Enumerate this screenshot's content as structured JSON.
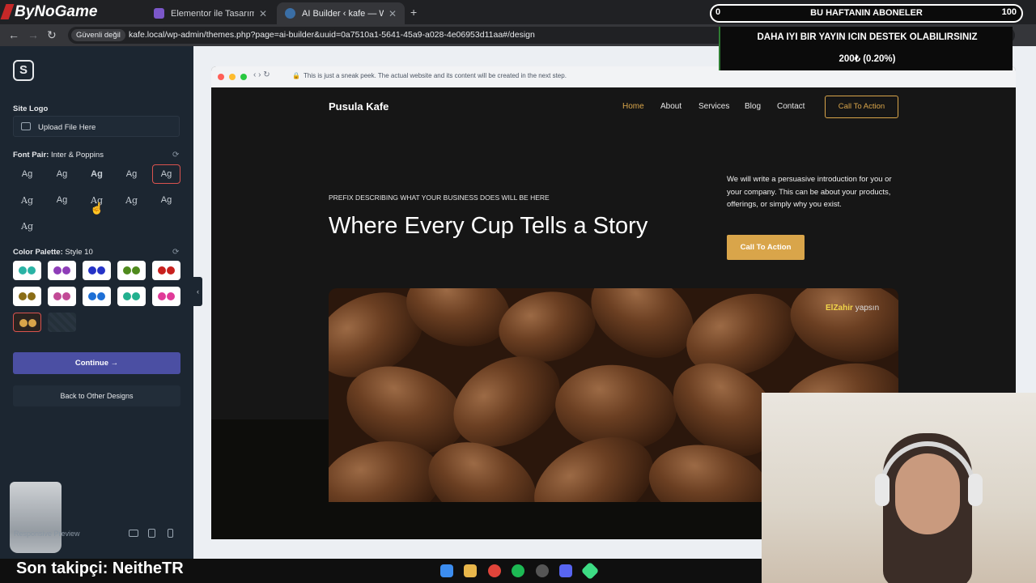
{
  "browser": {
    "tabs": [
      {
        "label": "Elementor ile Tasarım",
        "active": false
      },
      {
        "label": "AI Builder ‹ kafe — WordPress",
        "active": true
      }
    ],
    "new_tab_icon": "plus-icon",
    "security_label": "Güvenli değil",
    "url": "kafe.local/wp-admin/themes.php?page=ai-builder&uuid=0a7510a1-5641-45a9-a028-4e06953d11aa#/design"
  },
  "sidebar": {
    "site_logo_label": "Site Logo",
    "upload_label": "Upload File Here",
    "font_pair_label": "Font Pair:",
    "font_pair_value": "Inter & Poppins",
    "font_samples": [
      "Ag",
      "Ag",
      "Ag",
      "Ag",
      "Ag",
      "Ag",
      "Ag",
      "Ag",
      "Ag",
      "Ag",
      "Ag"
    ],
    "selected_font_index": 4,
    "color_palette_label": "Color Palette:",
    "color_palette_value": "Style 10",
    "palettes": [
      [
        "#2ab3a5",
        "#2ab3a5"
      ],
      [
        "#8e3db8",
        "#8e3db8"
      ],
      [
        "#2533c7",
        "#2533c7"
      ],
      [
        "#4f8a1d",
        "#4f8a1d"
      ],
      [
        "#c8201e",
        "#c8201e"
      ],
      [
        "#8a6d16",
        "#8a6d16"
      ],
      [
        "#c24a96",
        "#c24a96"
      ],
      [
        "#1d6fd6",
        "#1d6fd6"
      ],
      [
        "#22b08f",
        "#22b08f"
      ],
      [
        "#e03a98",
        "#e03a98"
      ],
      [
        "#d9a54a",
        "#d9a54a"
      ]
    ],
    "selected_palette_index": 10,
    "continue_label": "Continue →",
    "back_label": "Back to Other Designs",
    "responsive_preview_label": "Responsive Preview"
  },
  "preview": {
    "sneak_peek_text": "This is just a sneak peek. The actual website and its content will be created in the next step.",
    "site_title": "Pusula Kafe",
    "nav": [
      "Home",
      "About",
      "Services",
      "Blog",
      "Contact"
    ],
    "nav_cta": "Call To Action",
    "prefix": "PREFIX DESCRIBING WHAT YOUR BUSINESS DOES WILL BE HERE",
    "headline": "Where Every Cup Tells a Story",
    "intro": "We will write a persuasive introduction for you or your company. This can be about your products, offerings, or simply why you exist.",
    "hero_cta": "Call To Action",
    "accent_color": "#d9a54a"
  },
  "overlay": {
    "brand": "ByNoGame",
    "subs_left": "0",
    "subs_title": "BU HAFTANIN ABONELER",
    "subs_right": "100",
    "donate_line1": "DAHA IYI BIR YAYIN ICIN DESTEK OLABILIRSINIZ",
    "donate_line2": "200₺ (0.20%)",
    "chat_user": "ElZahir",
    "chat_text": "yapsın",
    "last_follower": "Son takipçi: NeitheTR"
  }
}
